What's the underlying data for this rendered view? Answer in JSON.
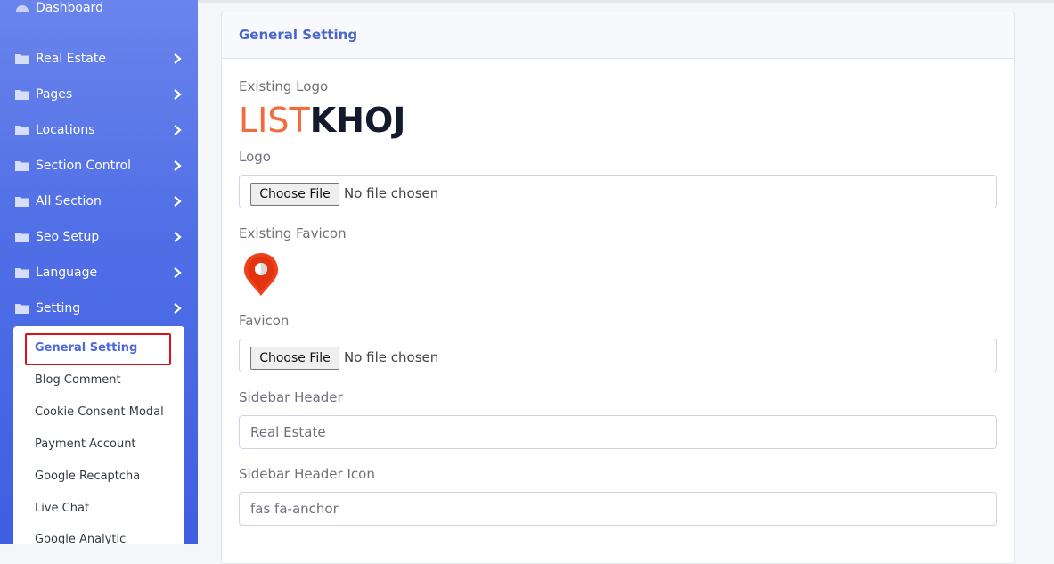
{
  "sidebar": {
    "dashboard": "Dashboard",
    "items": [
      {
        "label": "Real Estate"
      },
      {
        "label": "Pages"
      },
      {
        "label": "Locations"
      },
      {
        "label": "Section Control"
      },
      {
        "label": "All Section"
      },
      {
        "label": "Seo Setup"
      },
      {
        "label": "Language"
      },
      {
        "label": "Setting"
      }
    ],
    "submenu": [
      {
        "label": "General Setting",
        "active": true
      },
      {
        "label": "Blog Comment"
      },
      {
        "label": "Cookie Consent Modal"
      },
      {
        "label": "Payment Account"
      },
      {
        "label": "Google Recaptcha"
      },
      {
        "label": "Live Chat"
      },
      {
        "label": "Google Analytic"
      }
    ]
  },
  "card": {
    "title": "General Setting",
    "existing_logo_label": "Existing Logo",
    "logo_text_part1": "LIST",
    "logo_text_part2": "KHOJ",
    "logo_label": "Logo",
    "existing_favicon_label": "Existing Favicon",
    "favicon_label": "Favicon",
    "choose_file": "Choose File",
    "no_file": "No file chosen",
    "sidebar_header_label": "Sidebar Header",
    "sidebar_header_value": "Real Estate",
    "sidebar_header_icon_label": "Sidebar Header Icon",
    "sidebar_header_icon_value": "fas fa-anchor"
  },
  "colors": {
    "sidebar_gradient_top": "#6a84ec",
    "sidebar_gradient_bottom": "#3f5fe1",
    "accent": "#4a67e0",
    "highlight_box": "#e0101a",
    "logo_orange": "#f26b3a",
    "logo_dark": "#14192b",
    "favicon_red": "#f0401c"
  }
}
